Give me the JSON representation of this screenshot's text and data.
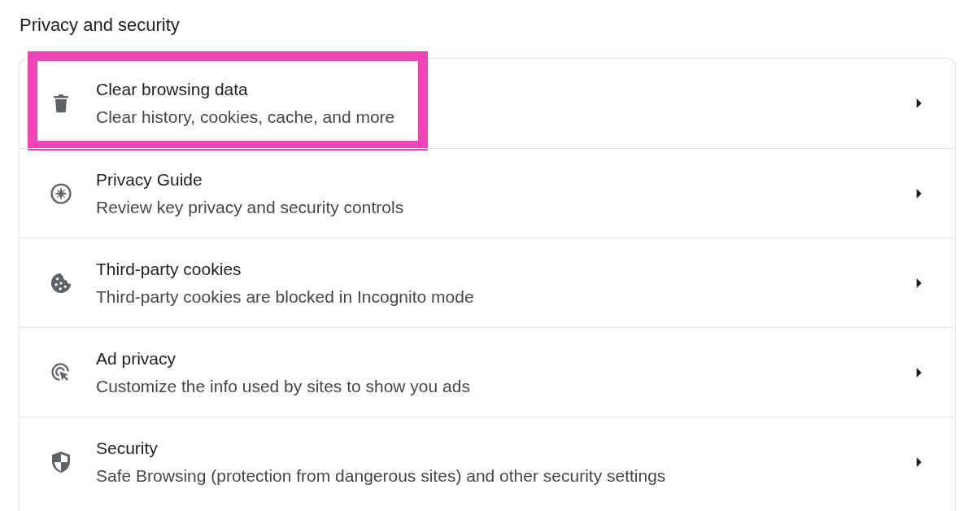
{
  "section_title": "Privacy and security",
  "items": [
    {
      "kind": "trash",
      "title": "Clear browsing data",
      "subtitle": "Clear history, cookies, cache, and more",
      "highlighted": true
    },
    {
      "kind": "compass",
      "title": "Privacy Guide",
      "subtitle": "Review key privacy and security controls",
      "highlighted": false
    },
    {
      "kind": "cookie",
      "title": "Third-party cookies",
      "subtitle": "Third-party cookies are blocked in Incognito mode",
      "highlighted": false
    },
    {
      "kind": "target",
      "title": "Ad privacy",
      "subtitle": "Customize the info used by sites to show you ads",
      "highlighted": false
    },
    {
      "kind": "shield",
      "title": "Security",
      "subtitle": "Safe Browsing (protection from dangerous sites) and other security settings",
      "highlighted": false
    }
  ]
}
